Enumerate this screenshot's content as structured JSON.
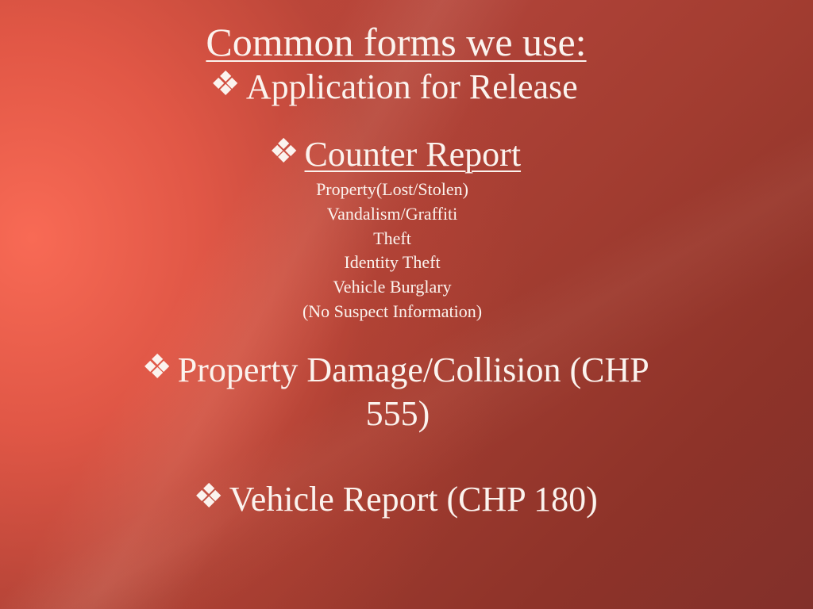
{
  "slide": {
    "title": "Common forms we use:",
    "items": [
      {
        "icon": "diamond-bullet-icon",
        "label": "Application for Release"
      },
      {
        "icon": "diamond-bullet-icon",
        "label": "Counter Report",
        "sub_items": [
          "Property(Lost/Stolen)",
          "Vandalism/Graffiti",
          "Theft",
          "Identity Theft",
          "Vehicle Burglary",
          "(No Suspect Information)"
        ]
      },
      {
        "icon": "diamond-bullet-icon",
        "label_line1": "Property Damage/Collision (CHP",
        "label_line2": "555)"
      },
      {
        "icon": "diamond-bullet-icon",
        "label": "Vehicle Report (CHP 180)"
      }
    ]
  },
  "colors": {
    "text": "#fbf3ee",
    "background_light": "#f86a55",
    "background_dark": "#82302a"
  }
}
